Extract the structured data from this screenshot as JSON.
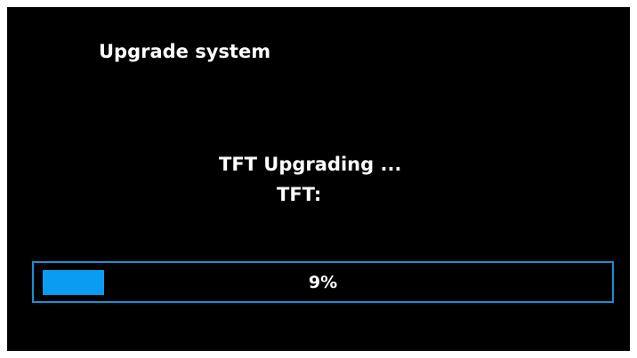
{
  "screen": {
    "title": "Upgrade system",
    "status_text": "TFT Upgrading ...",
    "detail_text": "TFT:"
  },
  "progress": {
    "percent": 9,
    "label": "9%",
    "fill_color": "#0a9cf0",
    "border_color": "#1a8fd6"
  }
}
